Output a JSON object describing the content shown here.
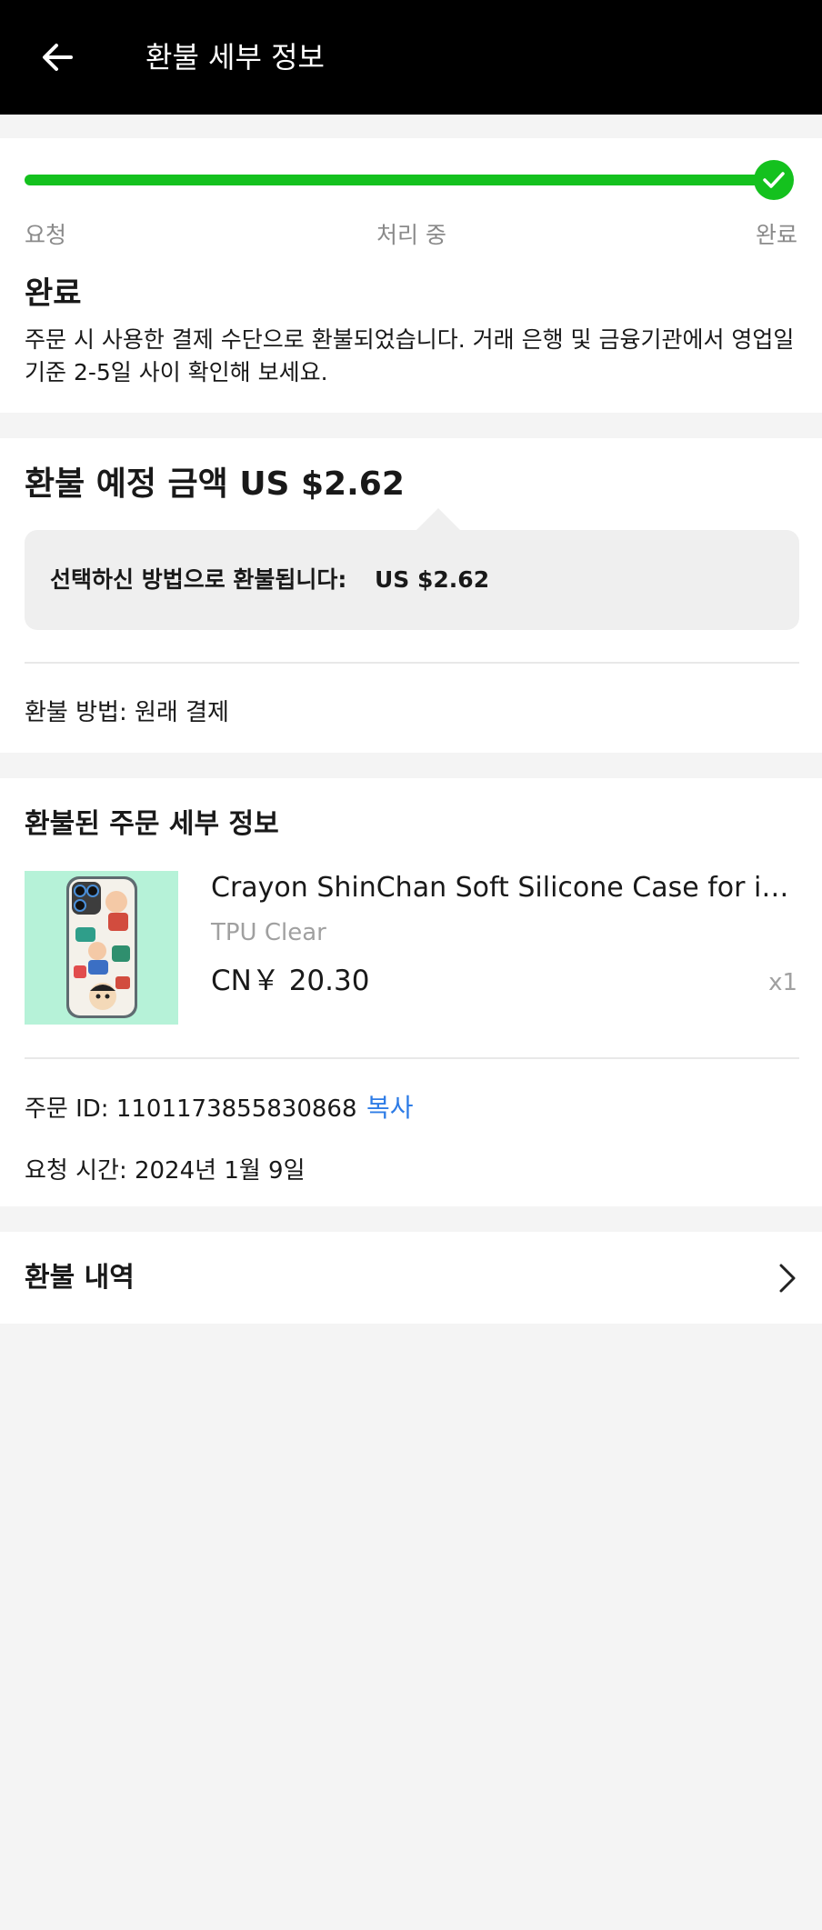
{
  "header": {
    "title": "환불 세부 정보"
  },
  "progress": {
    "steps": [
      "요청",
      "처리 중",
      "완료"
    ],
    "current_step": 3,
    "fraction_complete": 1.0,
    "accent_color": "#14c11e"
  },
  "status": {
    "title": "완료",
    "description": "주문 시 사용한 결제 수단으로 환불되었습니다. 거래 은행 및 금융기관에서 영업일 기준 2-5일 사이 확인해 보세요."
  },
  "refund": {
    "title": "환불 예정 금액 US $2.62",
    "method_label": "선택하신 방법으로 환불됩니다:",
    "method_amount": "US $2.62",
    "method": "환불 방법: 원래 결제"
  },
  "order_details": {
    "title": "환불된 주문 세부 정보",
    "product": {
      "name": "Crayon ShinChan Soft Silicone Case for iPhone",
      "variant": "TPU Clear",
      "price": "CN￥ 20.30",
      "quantity": "x1"
    },
    "order_id": "주문 ID: 1101173855830868",
    "copy_label": "복사",
    "request_time": "요청 시간: 2024년 1월 9일"
  },
  "history": {
    "label": "환불 내역"
  },
  "icons": {
    "back": "arrow-left-icon",
    "check": "check-icon",
    "chevron": "chevron-right-icon"
  },
  "colors": {
    "header_bg": "#000000",
    "success": "#14c11e",
    "link": "#2e7ce6",
    "muted": "#8a8a8a"
  }
}
